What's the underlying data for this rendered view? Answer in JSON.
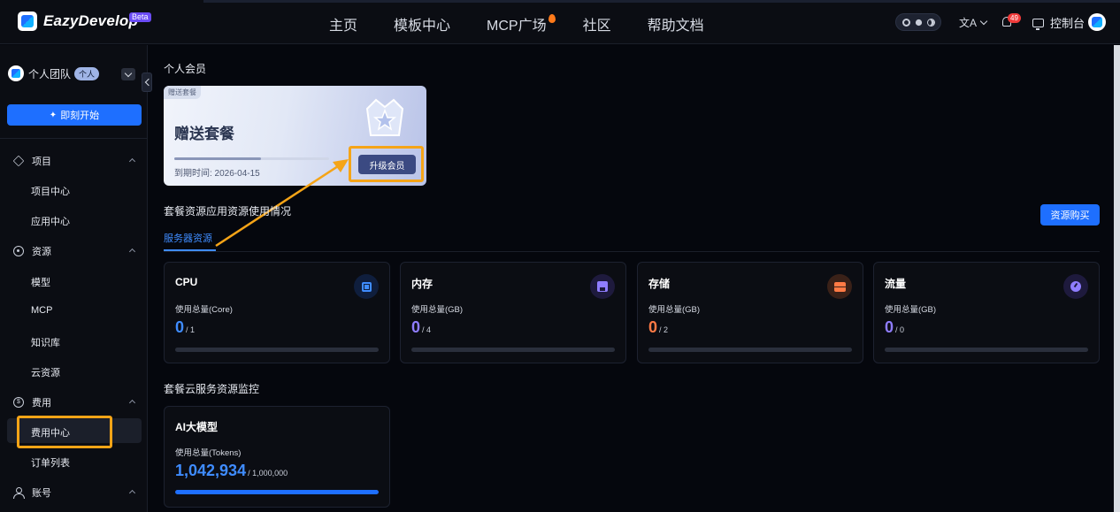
{
  "brand": {
    "name": "EazyDevelop",
    "beta": "Beta"
  },
  "nav": [
    "主页",
    "模板中心",
    "MCP广场",
    "社区",
    "帮助文档"
  ],
  "header": {
    "notifications": "49",
    "console": "控制台"
  },
  "sidebar": {
    "team_name": "个人团队",
    "team_tag": "个人",
    "start_button": "即刻开始",
    "groups": [
      {
        "label": "项目",
        "icon": "layers-icon",
        "items": [
          "项目中心",
          "应用中心"
        ]
      },
      {
        "label": "资源",
        "icon": "atom-icon",
        "items": [
          "模型",
          "MCP",
          "知识库",
          "云资源"
        ]
      },
      {
        "label": "费用",
        "icon": "coin-icon",
        "items": [
          "费用中心",
          "订单列表"
        ]
      },
      {
        "label": "账号",
        "icon": "user-icon",
        "items": []
      }
    ],
    "active_item": "费用中心"
  },
  "membership": {
    "section_title": "个人会员",
    "tag": "赠送套餐",
    "plan_name": "赠送套餐",
    "expiry": "到期时间: 2026-04-15",
    "progress": 0.56,
    "upgrade_button": "升级会员"
  },
  "usage": {
    "section_title": "套餐资源应用资源使用情况",
    "buy_button": "资源购买",
    "tab": "服务器资源",
    "cards": [
      {
        "title": "CPU",
        "label": "使用总量(Core)",
        "value": "0",
        "total": "/ 1",
        "color": "#3f8cff",
        "icon": "cpu-icon"
      },
      {
        "title": "内存",
        "label": "使用总量(GB)",
        "value": "0",
        "total": "/ 4",
        "color": "#8f7dff",
        "icon": "memory-icon"
      },
      {
        "title": "存储",
        "label": "使用总量(GB)",
        "value": "0",
        "total": "/ 2",
        "color": "#ff7a45",
        "icon": "storage-icon"
      },
      {
        "title": "流量",
        "label": "使用总量(GB)",
        "value": "0",
        "total": "/ 0",
        "color": "#8f7dff",
        "icon": "traffic-icon"
      }
    ]
  },
  "monitor": {
    "section_title": "套餐云服务资源监控",
    "ai": {
      "title": "AI大模型",
      "label": "使用总量(Tokens)",
      "value": "1,042,934",
      "total": "/ 1,000,000",
      "progress": 1.0
    }
  },
  "colors": {
    "accent": "#1e6fff",
    "highlight": "#f5a417",
    "background": "#05070d"
  }
}
